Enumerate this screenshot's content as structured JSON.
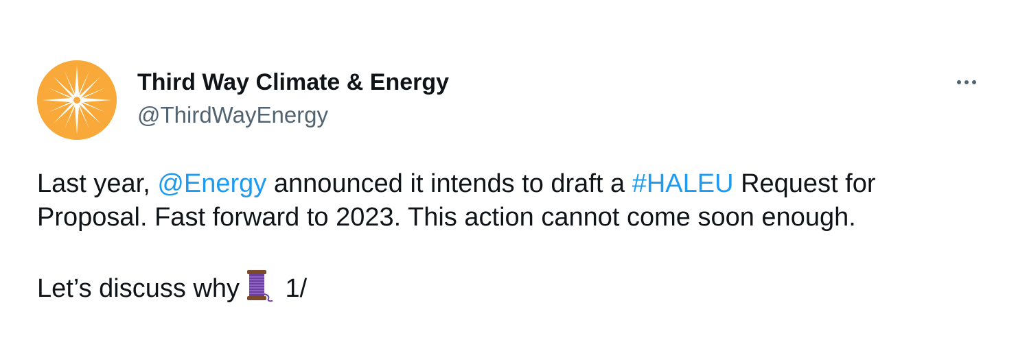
{
  "author": {
    "display_name": "Third Way Climate & Energy",
    "handle": "@ThirdWayEnergy",
    "avatar_icon": "sunburst-logo-icon",
    "avatar_color": "#F8A93A"
  },
  "menu": {
    "icon": "more-options-icon"
  },
  "tweet": {
    "line1": {
      "text_a": "Last year, ",
      "mention": "@Energy",
      "text_b": " announced it intends to draft a ",
      "hashtag": "#HALEU",
      "text_c": " Request for"
    },
    "line2": "Proposal. Fast forward to 2023. This action cannot come soon enough.",
    "line3": {
      "text_a": "Let’s discuss why",
      "emoji_icon": "spool-of-thread-icon",
      "text_b": " 1/"
    }
  },
  "colors": {
    "link": "#1d9bf0",
    "text": "#0f1419",
    "secondary": "#536471"
  }
}
